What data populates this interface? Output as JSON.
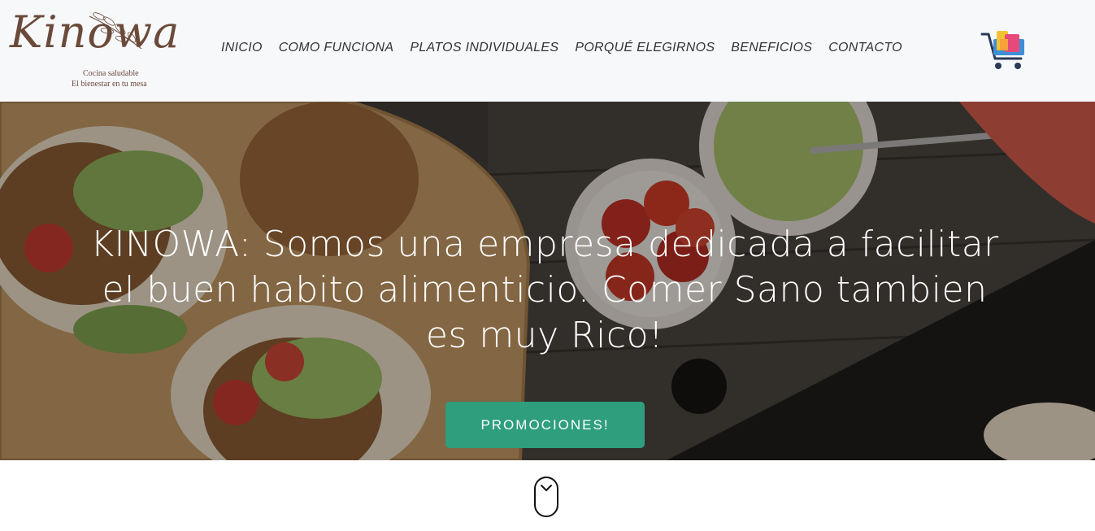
{
  "brand": {
    "name": "Kinowa",
    "tagline1": "Cocina saludable",
    "tagline2": "El bienestar en tu mesa",
    "color": "#6b4a3a"
  },
  "nav": {
    "items": [
      "INICIO",
      "COMO FUNCIONA",
      "PLATOS INDIVIDUALES",
      "PORQUÉ ELEGIRNOS",
      "BENEFICIOS",
      "CONTACTO"
    ]
  },
  "cart": {
    "icon": "shopping-cart-icon"
  },
  "hero": {
    "title": "KINOWA: Somos una empresa dedicada a facilitar el buen habito alimenticio. Comer Sano tambien es muy Rico!",
    "button_label": "PROMOCIONES!",
    "button_color": "#2e9e7c"
  },
  "scroll": {
    "icon": "scroll-down-mouse-icon"
  }
}
